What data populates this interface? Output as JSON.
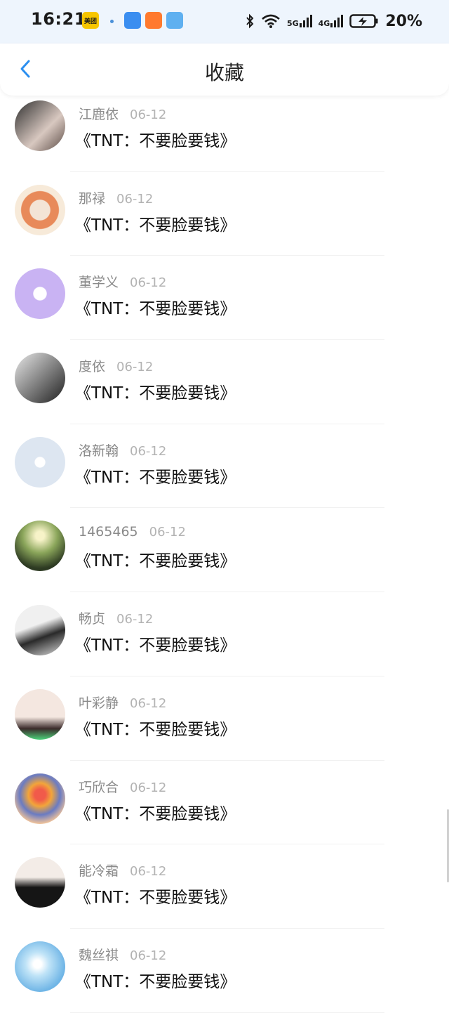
{
  "status_bar": {
    "time": "16:21",
    "app_icons": [
      {
        "name": "meituan-icon",
        "color": "#f7c600",
        "text": "美团"
      },
      {
        "name": "app-blue-icon",
        "color": "#3b8ef0"
      },
      {
        "name": "video-orange-icon",
        "color": "#ff7a2e"
      },
      {
        "name": "weather-icon",
        "color": "#5fb0f0"
      }
    ],
    "net1": "5G",
    "net2": "4G",
    "battery": "20%"
  },
  "header": {
    "title": "收藏",
    "back_icon": "chevron-left-icon",
    "accent": "#2b8ff0"
  },
  "favorites": [
    {
      "name": "江鹿依",
      "date": "06-12",
      "content": "《TNT：不要脸要钱》",
      "avatar": "linear-gradient(135deg,#2e2e2e,#d8c8c0 60%,#5a4a44)"
    },
    {
      "name": "那禄",
      "date": "06-12",
      "content": "《TNT：不要脸要钱》",
      "avatar": "radial-gradient(circle at 50% 50%,#f3e4d6 28%,#e88a5a 30%,#e88a5a 52%,#f7ead9 54%)"
    },
    {
      "name": "董学义",
      "date": "06-12",
      "content": "《TNT：不要脸要钱》",
      "avatar": "radial-gradient(circle at 50% 50%,#ffffff 18%,#c9b3f3 20%)"
    },
    {
      "name": "度依",
      "date": "06-12",
      "content": "《TNT：不要脸要钱》",
      "avatar": "linear-gradient(135deg,#e8e8e8,#7a7a7a 55%,#1f1f1f)"
    },
    {
      "name": "洛新翰",
      "date": "06-12",
      "content": "《TNT：不要脸要钱》",
      "avatar": "radial-gradient(circle at 50% 50%,#ffffff 14%,#dde6f1 16%)"
    },
    {
      "name": "1465465",
      "date": "06-12",
      "content": "《TNT：不要脸要钱》",
      "avatar": "radial-gradient(circle at 50% 30%,#f7f3c8 10%,#8aa55a 40%,#2d3a22 75%)"
    },
    {
      "name": "畅贞",
      "date": "06-12",
      "content": "《TNT：不要脸要钱》",
      "avatar": "linear-gradient(160deg,#f0f0f0 40%,#2a2a2a 62%,#dcdcdc)"
    },
    {
      "name": "叶彩静",
      "date": "06-12",
      "content": "《TNT：不要脸要钱》",
      "avatar": "linear-gradient(180deg,#f4e7e0 55%,#3a2a2a 78%,#4cd27a)"
    },
    {
      "name": "巧欣合",
      "date": "06-12",
      "content": "《TNT：不要脸要钱》",
      "avatar": "radial-gradient(circle at 50% 42%,#f15a4a 14%,#f2a53a 30%,#6a7bc2 52%,#f0c39a 75%)"
    },
    {
      "name": "能冷霜",
      "date": "06-12",
      "content": "《TNT：不要脸要钱》",
      "avatar": "linear-gradient(180deg,#f3ece7 40%,#151515 60%)"
    },
    {
      "name": "魏丝祺",
      "date": "06-12",
      "content": "《TNT：不要脸要钱》",
      "avatar": "radial-gradient(circle at 45% 45%,#ffffff 10%,#bfe3f7 30%,#6fb5e6 70%)"
    }
  ]
}
